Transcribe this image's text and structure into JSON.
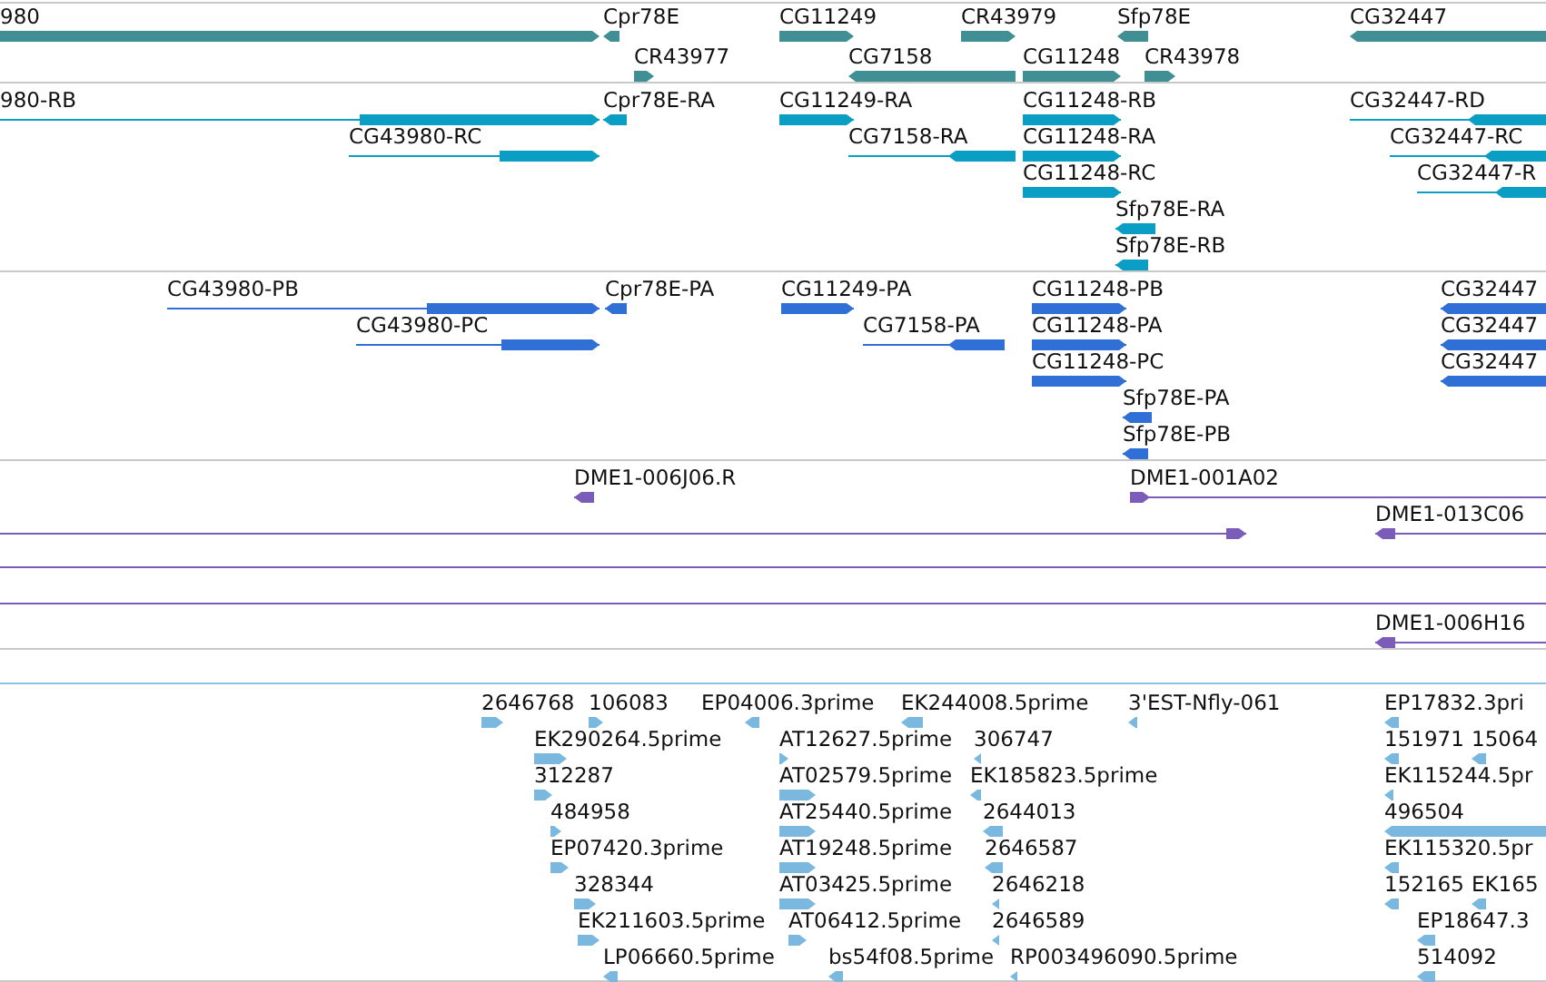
{
  "tracks": [
    {
      "kind": "gene",
      "features": [
        {
          "label": "980",
          "reverse": false
        },
        {
          "label": "Cpr78E",
          "reverse": true
        },
        {
          "label": "CG11249",
          "reverse": false
        },
        {
          "label": "CR43979",
          "reverse": false
        },
        {
          "label": "Sfp78E",
          "reverse": true
        },
        {
          "label": "CG32447",
          "reverse": true
        },
        {
          "label": "CR43977",
          "reverse": false
        },
        {
          "label": "CG7158",
          "reverse": true
        },
        {
          "label": "CG11248",
          "reverse": false
        },
        {
          "label": "CR43978",
          "reverse": false
        }
      ]
    },
    {
      "kind": "transcript",
      "features": [
        {
          "label": "980-RB",
          "reverse": false
        },
        {
          "label": "Cpr78E-RA",
          "reverse": true
        },
        {
          "label": "CG11249-RA",
          "reverse": false
        },
        {
          "label": "CG11248-RB",
          "reverse": false
        },
        {
          "label": "CG32447-RD",
          "reverse": true
        },
        {
          "label": "CG43980-RC",
          "reverse": false
        },
        {
          "label": "CG7158-RA",
          "reverse": true
        },
        {
          "label": "CG11248-RA",
          "reverse": false
        },
        {
          "label": "CG32447-RC",
          "reverse": true
        },
        {
          "label": "CG11248-RC",
          "reverse": false
        },
        {
          "label": "CG32447-R",
          "reverse": true
        },
        {
          "label": "Sfp78E-RA",
          "reverse": true
        },
        {
          "label": "Sfp78E-RB",
          "reverse": true
        }
      ]
    },
    {
      "kind": "protein",
      "features": [
        {
          "label": "CG43980-PB",
          "reverse": false
        },
        {
          "label": "Cpr78E-PA",
          "reverse": true
        },
        {
          "label": "CG11249-PA",
          "reverse": false
        },
        {
          "label": "CG11248-PB",
          "reverse": false
        },
        {
          "label": "CG32447",
          "reverse": true
        },
        {
          "label": "CG43980-PC",
          "reverse": false
        },
        {
          "label": "CG7158-PA",
          "reverse": true
        },
        {
          "label": "CG11248-PA",
          "reverse": false
        },
        {
          "label": "CG32447",
          "reverse": true
        },
        {
          "label": "CG11248-PC",
          "reverse": false
        },
        {
          "label": "CG32447",
          "reverse": true
        },
        {
          "label": "Sfp78E-PA",
          "reverse": true
        },
        {
          "label": "Sfp78E-PB",
          "reverse": true
        }
      ]
    },
    {
      "kind": "clone",
      "features": [
        {
          "label": "DME1-006J06.R",
          "reverse": true
        },
        {
          "label": "DME1-001A02",
          "reverse": false
        },
        {
          "reverse": false
        },
        {
          "label": "DME1-013C06",
          "reverse": true
        },
        {
          "label": "DME1-006H16",
          "reverse": true
        }
      ]
    },
    {
      "kind": "est",
      "features": [
        {
          "label": "2646768",
          "reverse": false
        },
        {
          "label": "106083",
          "reverse": false
        },
        {
          "label": "EP04006.3prime",
          "reverse": true
        },
        {
          "label": "EK244008.5prime",
          "reverse": true
        },
        {
          "label": "3'EST-Nfly-061",
          "reverse": true
        },
        {
          "label": "EP17832.3pri",
          "reverse": true
        },
        {
          "label": "EK290264.5prime",
          "reverse": false
        },
        {
          "label": "AT12627.5prime",
          "reverse": false
        },
        {
          "label": "306747",
          "reverse": true
        },
        {
          "label": "151971",
          "reverse": true
        },
        {
          "label": "15064",
          "reverse": true
        },
        {
          "label": "312287",
          "reverse": false
        },
        {
          "label": "AT02579.5prime",
          "reverse": false
        },
        {
          "label": "EK185823.5prime",
          "reverse": true
        },
        {
          "label": "EK115244.5pr",
          "reverse": true
        },
        {
          "label": "484958",
          "reverse": false
        },
        {
          "label": "AT25440.5prime",
          "reverse": false
        },
        {
          "label": "2644013",
          "reverse": true
        },
        {
          "label": "496504",
          "reverse": true
        },
        {
          "label": "EP07420.3prime",
          "reverse": false
        },
        {
          "label": "AT19248.5prime",
          "reverse": false
        },
        {
          "label": "2646587",
          "reverse": true
        },
        {
          "label": "EK115320.5pr",
          "reverse": true
        },
        {
          "label": "328344",
          "reverse": false
        },
        {
          "label": "AT03425.5prime",
          "reverse": false
        },
        {
          "label": "2646218",
          "reverse": true
        },
        {
          "label": "152165",
          "reverse": true
        },
        {
          "label": "EK165",
          "reverse": true
        },
        {
          "label": "EK211603.5prime",
          "reverse": false
        },
        {
          "label": "AT06412.5prime",
          "reverse": false
        },
        {
          "label": "2646589",
          "reverse": true
        },
        {
          "label": "EP18647.3",
          "reverse": true
        },
        {
          "label": "LP06660.5prime",
          "reverse": true
        },
        {
          "label": "bs54f08.5prime",
          "reverse": true
        },
        {
          "label": "RP003496090.5prime",
          "reverse": true
        },
        {
          "label": "514092",
          "reverse": true
        }
      ]
    }
  ]
}
